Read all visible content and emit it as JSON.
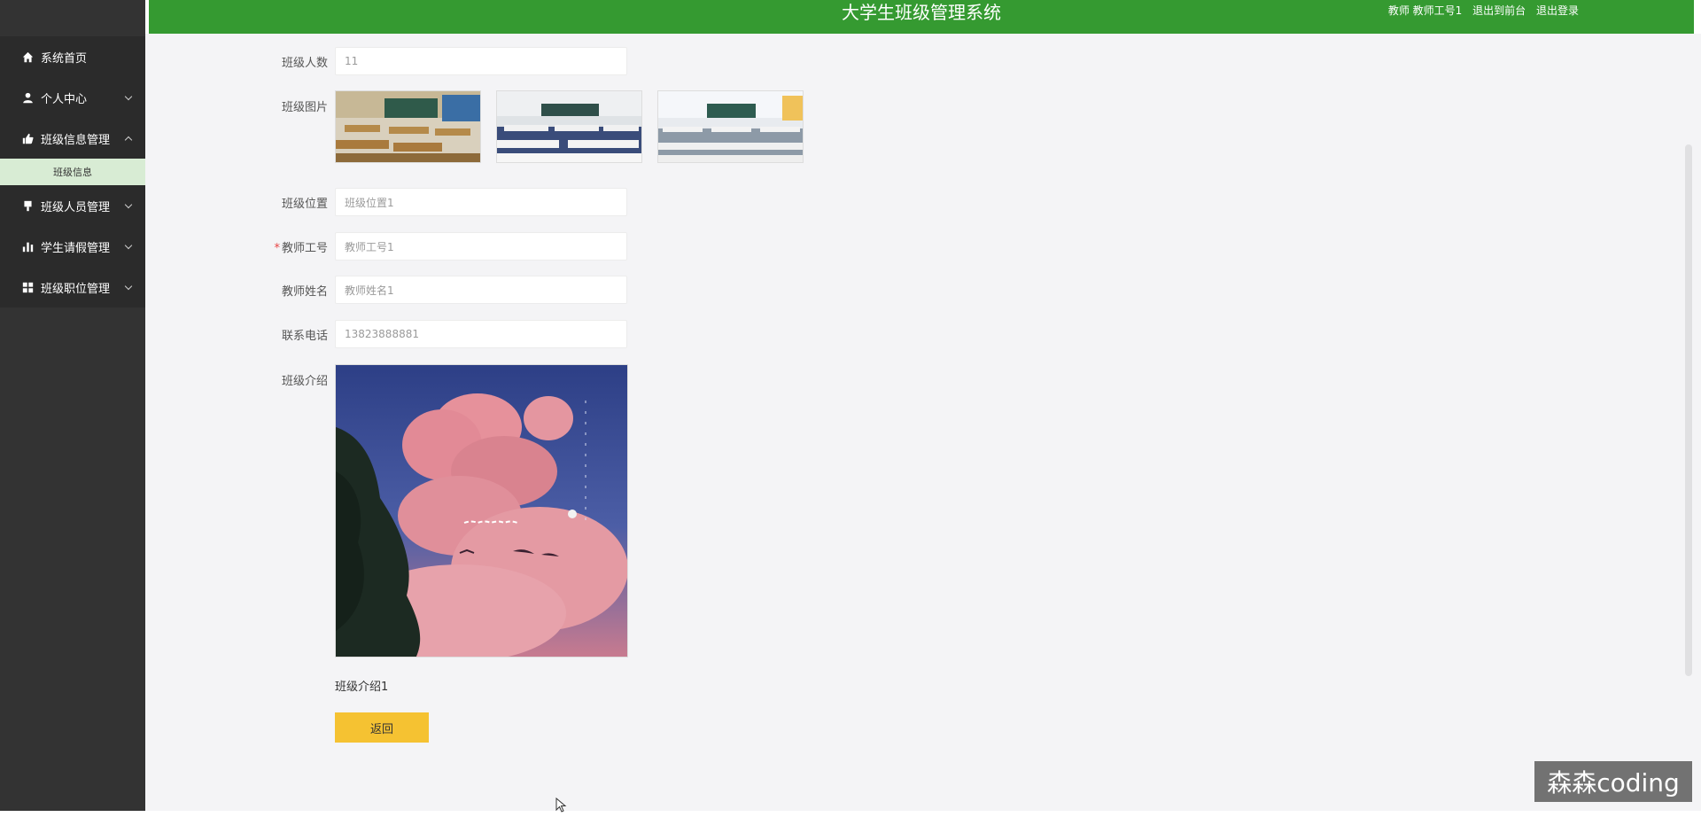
{
  "header": {
    "title": "大学生班级管理系统",
    "user_label": "教师 教师工号1",
    "front_link": "退出到前台",
    "logout_link": "退出登录"
  },
  "sidebar": {
    "items": [
      {
        "label": "系统首页",
        "icon": "home-icon"
      },
      {
        "label": "个人中心",
        "icon": "user-icon"
      },
      {
        "label": "班级信息管理",
        "icon": "class-info-icon",
        "expanded": true,
        "children": [
          {
            "label": "班级信息",
            "active": true
          }
        ]
      },
      {
        "label": "班级人员管理",
        "icon": "members-icon"
      },
      {
        "label": "学生请假管理",
        "icon": "chart-icon"
      },
      {
        "label": "班级职位管理",
        "icon": "grid-icon"
      }
    ]
  },
  "form": {
    "class_size": {
      "label": "班级人数",
      "value": "11"
    },
    "class_images": {
      "label": "班级图片"
    },
    "location": {
      "label": "班级位置",
      "value": "班级位置1"
    },
    "teacher_id": {
      "label": "教师工号",
      "value": "教师工号1",
      "required": true
    },
    "teacher_name": {
      "label": "教师姓名",
      "value": "教师姓名1"
    },
    "phone": {
      "label": "联系电话",
      "value": "13823888881"
    },
    "intro": {
      "label": "班级介绍",
      "text": "班级介绍1"
    },
    "back_button": "返回"
  },
  "watermark": "森森coding",
  "colors": {
    "header_green": "#359a31",
    "sidebar_bg": "#333333",
    "active_submenu_bg": "#d8ecd4",
    "button_yellow": "#f5c232"
  }
}
